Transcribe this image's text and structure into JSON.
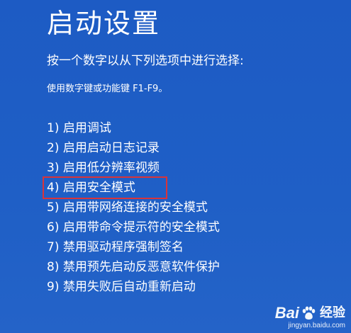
{
  "screen": {
    "title": "启动设置",
    "subtitle": "按一个数字以从下列选项中进行选择:",
    "hint": "使用数字键或功能键 F1-F9。",
    "options": [
      "1) 启用调试",
      "2) 启用启动日志记录",
      "3) 启用低分辨率视频",
      "4) 启用安全模式",
      "5) 启用带网络连接的安全模式",
      "6) 启用带命令提示符的安全模式",
      "7) 禁用驱动程序强制签名",
      "8) 禁用预先启动反恶意软件保护",
      "9) 禁用失败后自动重新启动"
    ],
    "highlighted_option_index": 3
  },
  "watermark": {
    "brand_left": "Bai",
    "brand_right": "经验",
    "url": "jingyan.baidu.com",
    "icon": "baidu-paw-icon"
  },
  "colors": {
    "background": "#1f5cc3",
    "text": "#ffffff",
    "highlight_border": "#d8343a"
  }
}
